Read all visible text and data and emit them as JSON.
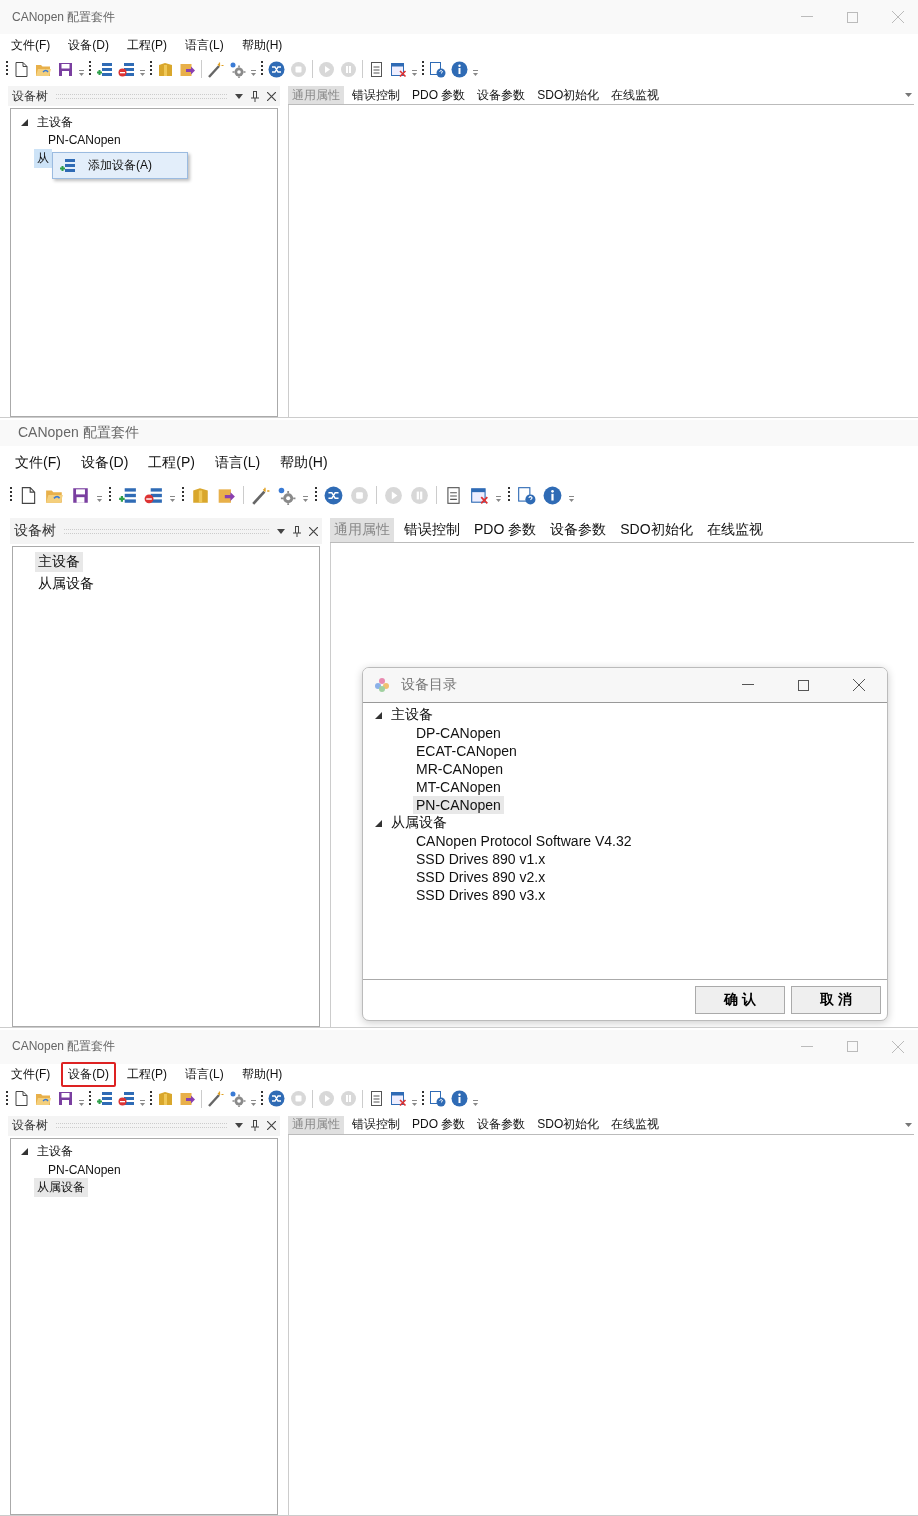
{
  "screens": [
    {
      "title": "CANopen 配置套件",
      "window_controls": true,
      "tree_focused": true,
      "menu": [
        {
          "label": "文件(F)",
          "highlighted": false
        },
        {
          "label": "设备(D)",
          "highlighted": false
        },
        {
          "label": "工程(P)",
          "highlighted": false
        },
        {
          "label": "语言(L)",
          "highlighted": false
        },
        {
          "label": "帮助(H)",
          "highlighted": false
        }
      ],
      "tree_panel": {
        "title": "设备树"
      },
      "tree": [
        {
          "label": "主设备",
          "selected": false,
          "children": [
            {
              "label": "PN-CANopen",
              "selected": false
            }
          ]
        },
        {
          "label": "从",
          "selected": true
        }
      ],
      "context_menu": {
        "items": [
          {
            "label": "添加设备(A)"
          }
        ]
      },
      "tabs": [
        {
          "label": "通用属性",
          "selected": true
        },
        {
          "label": "错误控制",
          "selected": false
        },
        {
          "label": "PDO 参数",
          "selected": false
        },
        {
          "label": "设备参数",
          "selected": false
        },
        {
          "label": "SDO初始化",
          "selected": false
        },
        {
          "label": "在线监视",
          "selected": false
        }
      ],
      "tab_overflow": true
    },
    {
      "title": "CANopen 配置套件",
      "window_controls": false,
      "tree_focused": false,
      "menu": [
        {
          "label": "文件(F)",
          "highlighted": false
        },
        {
          "label": "设备(D)",
          "highlighted": false
        },
        {
          "label": "工程(P)",
          "highlighted": false
        },
        {
          "label": "语言(L)",
          "highlighted": false
        },
        {
          "label": "帮助(H)",
          "highlighted": false
        }
      ],
      "tree_panel": {
        "title": "设备树"
      },
      "tree": [
        {
          "label": "主设备",
          "selected": true
        },
        {
          "label": "从属设备",
          "selected": false
        }
      ],
      "tabs": [
        {
          "label": "通用属性",
          "selected": true
        },
        {
          "label": "错误控制",
          "selected": false
        },
        {
          "label": "PDO 参数",
          "selected": false
        },
        {
          "label": "设备参数",
          "selected": false
        },
        {
          "label": "SDO初始化",
          "selected": false
        },
        {
          "label": "在线监视",
          "selected": false
        }
      ],
      "tab_overflow": false,
      "dialog": {
        "title": "设备目录",
        "tree": [
          {
            "label": "主设备",
            "selected": false,
            "children": [
              {
                "label": "DP-CANopen",
                "selected": false
              },
              {
                "label": "ECAT-CANopen",
                "selected": false
              },
              {
                "label": "MR-CANopen",
                "selected": false
              },
              {
                "label": "MT-CANopen",
                "selected": false
              },
              {
                "label": "PN-CANopen",
                "selected": true
              }
            ]
          },
          {
            "label": "从属设备",
            "selected": false,
            "children": [
              {
                "label": "CANopen Protocol Software V4.32",
                "selected": false
              },
              {
                "label": "SSD Drives 890 v1.x",
                "selected": false
              },
              {
                "label": "SSD Drives 890 v2.x",
                "selected": false
              },
              {
                "label": "SSD Drives 890 v3.x",
                "selected": false
              }
            ]
          }
        ],
        "buttons": [
          {
            "label": "确 认"
          },
          {
            "label": "取 消"
          }
        ]
      }
    },
    {
      "title": "CANopen 配置套件",
      "window_controls": true,
      "tree_focused": false,
      "menu": [
        {
          "label": "文件(F)",
          "highlighted": false
        },
        {
          "label": "设备(D)",
          "highlighted": true
        },
        {
          "label": "工程(P)",
          "highlighted": false
        },
        {
          "label": "语言(L)",
          "highlighted": false
        },
        {
          "label": "帮助(H)",
          "highlighted": false
        }
      ],
      "tree_panel": {
        "title": "设备树"
      },
      "tree": [
        {
          "label": "主设备",
          "selected": false,
          "children": [
            {
              "label": "PN-CANopen",
              "selected": false
            }
          ]
        },
        {
          "label": "从属设备",
          "selected": true
        }
      ],
      "tabs": [
        {
          "label": "通用属性",
          "selected": true
        },
        {
          "label": "错误控制",
          "selected": false
        },
        {
          "label": "PDO 参数",
          "selected": false
        },
        {
          "label": "设备参数",
          "selected": false
        },
        {
          "label": "SDO初始化",
          "selected": false
        },
        {
          "label": "在线监视",
          "selected": false
        }
      ],
      "tab_overflow": true
    }
  ]
}
